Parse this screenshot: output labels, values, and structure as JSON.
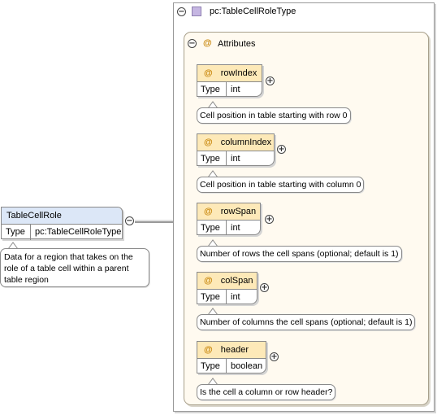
{
  "complex_type": {
    "name": "pc:TableCellRoleType",
    "icon": "complex-type-icon"
  },
  "attributes_group": {
    "title": "Attributes"
  },
  "attributes": [
    {
      "name": "rowIndex",
      "type_label": "Type",
      "type": "int",
      "doc": "Cell position in table starting with row 0"
    },
    {
      "name": "columnIndex",
      "type_label": "Type",
      "type": "int",
      "doc": "Cell position in table starting with column 0"
    },
    {
      "name": "rowSpan",
      "type_label": "Type",
      "type": "int",
      "doc": "Number of rows the cell spans (optional; default is 1)"
    },
    {
      "name": "colSpan",
      "type_label": "Type",
      "type": "int",
      "doc": "Number of columns the cell spans (optional; default is 1)"
    },
    {
      "name": "header",
      "type_label": "Type",
      "type": "boolean",
      "doc": "Is the cell a column or row header?"
    }
  ],
  "element": {
    "name": "TableCellRole",
    "type_label": "Type",
    "type": "pc:TableCellRoleType",
    "doc": "Data for a region that takes on the role of a table cell within a parent table region"
  },
  "symbols": {
    "attribute": "@",
    "collapse": "−",
    "expand": "+"
  }
}
